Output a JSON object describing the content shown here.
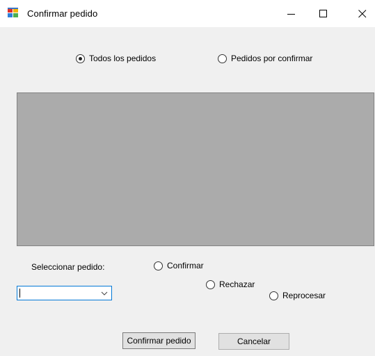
{
  "window": {
    "title": "Confirmar pedido"
  },
  "filter": {
    "option_all": "Todos los pedidos",
    "option_pending": "Pedidos por confirmar",
    "selected": "option_all"
  },
  "selection": {
    "label": "Seleccionar pedido:",
    "combo_value": ""
  },
  "action": {
    "confirm": "Confirmar",
    "reject": "Rechazar",
    "reprocess": "Reprocesar"
  },
  "buttons": {
    "confirm_order": "Confirmar pedido",
    "cancel": "Cancelar"
  },
  "icons": {
    "app": "windows-forms-app-icon",
    "minimize": "minimize-icon",
    "maximize": "maximize-icon",
    "close": "close-icon",
    "dropdown": "chevron-down-icon"
  },
  "colors": {
    "window_bg": "#f0f0f0",
    "titlebar_bg": "#ffffff",
    "grid_bg": "#ababab",
    "focus_border": "#0078d7",
    "button_bg": "#e1e1e1"
  }
}
